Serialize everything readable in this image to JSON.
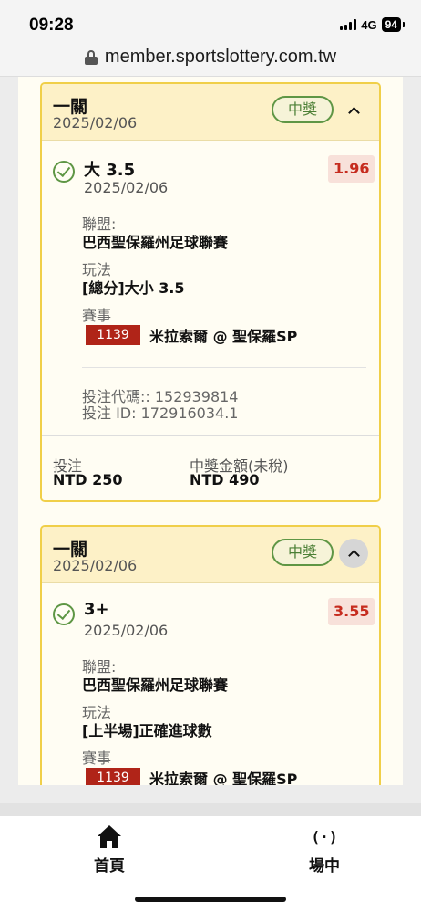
{
  "status_bar": {
    "time": "09:28",
    "network": "4G",
    "battery": "94"
  },
  "browser": {
    "url": "member.sportslottery.com.tw"
  },
  "cards": [
    {
      "title": "一關",
      "date": "2025/02/06",
      "status_badge": "中獎",
      "selection": {
        "name": "大 3.5",
        "date": "2025/02/06",
        "odds": "1.96",
        "league_label": "聯盟:",
        "league": "巴西聖保羅州足球聯賽",
        "market_label": "玩法",
        "market": "[總分]大小 3.5",
        "event_label": "賽事",
        "match_code": "1139",
        "match": "米拉索爾 @ 聖保羅SP"
      },
      "bet_code": "投注代碼:: 152939814",
      "bet_id": "投注 ID: 172916034.1",
      "stake_label": "投注",
      "stake": "NTD 250",
      "payout_label": "中獎金額(未稅)",
      "payout": "NTD 490"
    },
    {
      "title": "一關",
      "date": "2025/02/06",
      "status_badge": "中獎",
      "selection": {
        "name": "3+",
        "date": "2025/02/06",
        "odds": "3.55",
        "league_label": "聯盟:",
        "league": "巴西聖保羅州足球聯賽",
        "market_label": "玩法",
        "market": "[上半場]正確進球數",
        "event_label": "賽事",
        "match_code": "1139",
        "match": "米拉索爾 @ 聖保羅SP"
      }
    }
  ],
  "tab_bar": {
    "home_label": "首頁",
    "home_icon": "home-icon",
    "live_label": "場中",
    "live_icon": "live-broadcast-icon",
    "live_glyph": "(·)"
  },
  "colors": {
    "card_border": "#f0cf49",
    "card_header": "#fdf1c7",
    "win_green": "#5f9645",
    "odds_red": "#c62c1f",
    "match_code_bg": "#b02418"
  }
}
